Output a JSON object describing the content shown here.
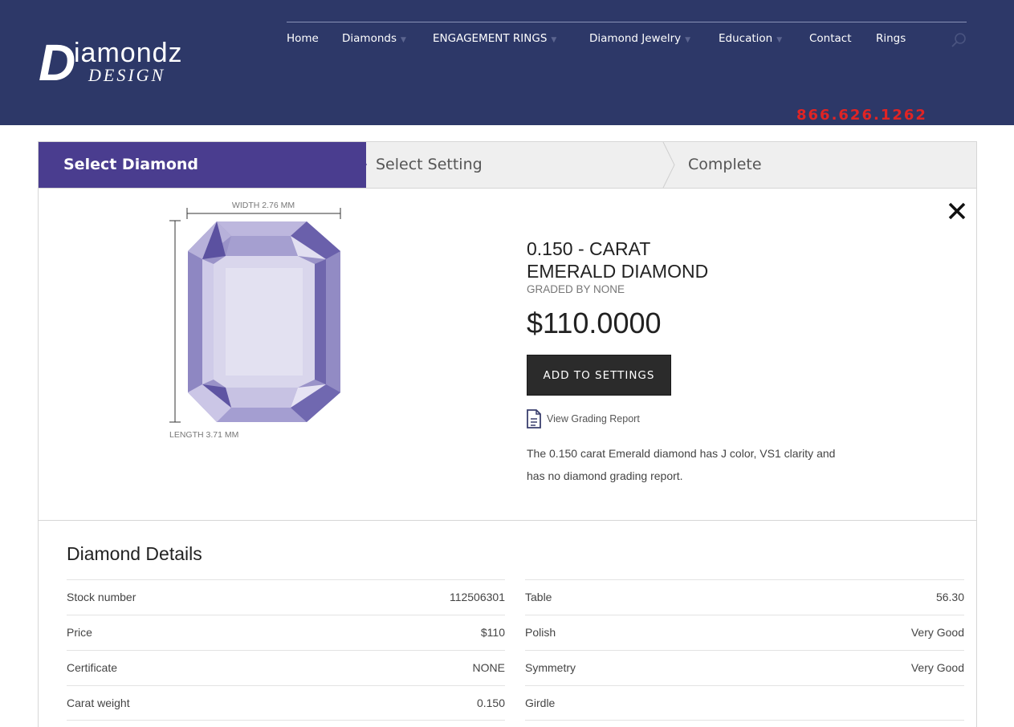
{
  "brand": {
    "logo_top": "iamondz",
    "logo_d": "D",
    "logo_bottom": "DESIGN",
    "phone": "866.626.1262"
  },
  "nav": {
    "items": [
      {
        "label": "Home",
        "has_caret": false
      },
      {
        "label": "Diamonds",
        "has_caret": true
      },
      {
        "label": "ENGAGEMENT RINGS",
        "has_caret": true
      },
      {
        "label": "Diamond Jewelry",
        "has_caret": true
      },
      {
        "label": "Education",
        "has_caret": true
      },
      {
        "label": "Contact",
        "has_caret": false
      },
      {
        "label": "Rings",
        "has_caret": false
      }
    ],
    "search_icon": "search-icon"
  },
  "steps": {
    "step1": "Select Diamond",
    "step2": "Select Setting",
    "step3": "Complete"
  },
  "diamond": {
    "width_label": "WIDTH 2.76 MM",
    "length_label": "LENGTH 3.71 MM",
    "title_line1": "0.150 - CARAT",
    "title_line2": "EMERALD DIAMOND",
    "graded": "GRADED BY NONE",
    "price": "$110.0000",
    "add_button": "ADD TO SETTINGS",
    "report_link": "View Grading Report",
    "description": "The 0.150 carat Emerald diamond has J color, VS1 clarity and has no diamond grading report."
  },
  "details": {
    "title": "Diamond Details",
    "left": [
      {
        "key": "Stock number",
        "value": "112506301"
      },
      {
        "key": "Price",
        "value": "$110"
      },
      {
        "key": "Certificate",
        "value": "NONE"
      },
      {
        "key": "Carat weight",
        "value": "0.150"
      }
    ],
    "right": [
      {
        "key": "Table",
        "value": "56.30"
      },
      {
        "key": "Polish",
        "value": "Very Good"
      },
      {
        "key": "Symmetry",
        "value": "Very Good"
      },
      {
        "key": "Girdle",
        "value": ""
      }
    ]
  },
  "colors": {
    "header_bg": "#2d3868",
    "step_active": "#4a3d8f",
    "phone": "#e02424",
    "button": "#2b2b2b"
  }
}
